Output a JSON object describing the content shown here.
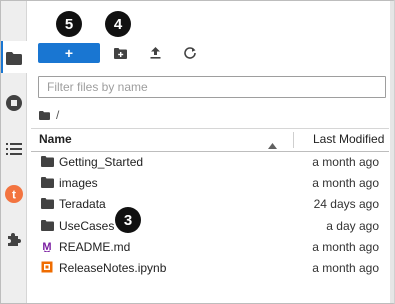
{
  "toolbar": {
    "new_label": "+",
    "icons": [
      "new-folder-icon",
      "upload-icon",
      "refresh-icon"
    ]
  },
  "badges": {
    "new_button": "5",
    "new_folder": "4",
    "usecases": "3"
  },
  "filter": {
    "placeholder": "Filter files by name",
    "value": ""
  },
  "breadcrumb": {
    "separator": "/"
  },
  "table": {
    "columns": [
      "Name",
      "Last Modified"
    ],
    "sort_icon": "sort-ascending-icon",
    "rows": [
      {
        "name": "Getting_Started",
        "type": "folder",
        "modified": "a month ago"
      },
      {
        "name": "images",
        "type": "folder",
        "modified": "a month ago"
      },
      {
        "name": "Teradata",
        "type": "folder",
        "modified": "24 days ago"
      },
      {
        "name": "UseCases",
        "type": "folder",
        "modified": "a day ago"
      },
      {
        "name": "README.md",
        "type": "markdown",
        "modified": "a month ago"
      },
      {
        "name": "ReleaseNotes.ipynb",
        "type": "notebook",
        "modified": "a month ago"
      }
    ]
  },
  "activity_bar": [
    "folder-icon",
    "stop-circle-icon",
    "list-icon",
    "teradata-icon",
    "extension-icon"
  ],
  "colors": {
    "accent": "#1976d2",
    "teradata": "#f37440",
    "markdown": "#7b1fa2",
    "notebook": "#ef6c00",
    "folder": "#424242"
  }
}
